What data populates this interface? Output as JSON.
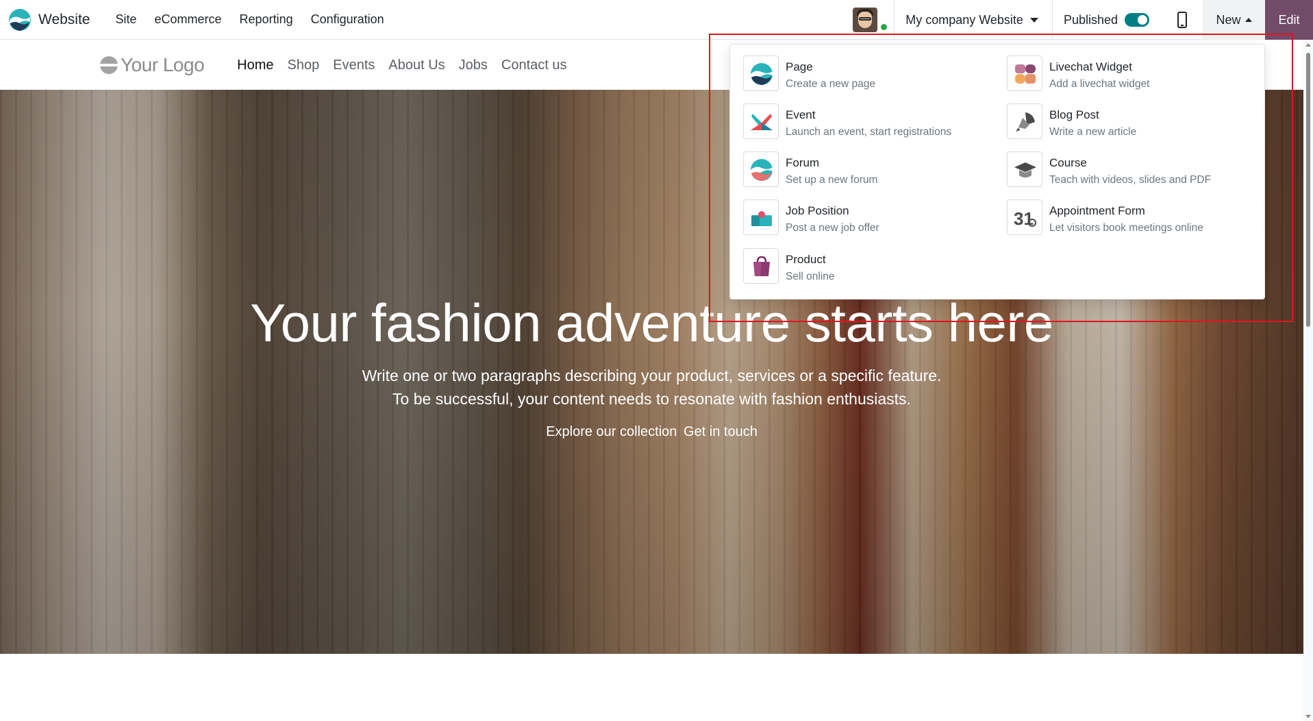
{
  "topbar": {
    "app_name": "Website",
    "menu": [
      "Site",
      "eCommerce",
      "Reporting",
      "Configuration"
    ],
    "website_selector": "My company Website",
    "published_label": "Published",
    "published": true,
    "new_label": "New",
    "edit_label": "Edit"
  },
  "site_header": {
    "logo_text": "Your Logo",
    "nav": [
      "Home",
      "Shop",
      "Events",
      "About Us",
      "Jobs",
      "Contact us"
    ],
    "active": "Home"
  },
  "hero": {
    "title": "Your fashion adventure starts here",
    "paragraph_line1": "Write one or two paragraphs describing your product, services or a specific feature.",
    "paragraph_line2": "To be successful, your content needs to resonate with fashion enthusiasts.",
    "link1": "Explore our collection",
    "link2": "Get in touch"
  },
  "new_menu": {
    "items": [
      {
        "title": "Page",
        "subtitle": "Create a new page",
        "icon": "page-icon"
      },
      {
        "title": "Livechat Widget",
        "subtitle": "Add a livechat widget",
        "icon": "livechat-icon"
      },
      {
        "title": "Event",
        "subtitle": "Launch an event, start registrations",
        "icon": "event-icon"
      },
      {
        "title": "Blog Post",
        "subtitle": "Write a new article",
        "icon": "blog-icon"
      },
      {
        "title": "Forum",
        "subtitle": "Set up a new forum",
        "icon": "forum-icon"
      },
      {
        "title": "Course",
        "subtitle": "Teach with videos, slides and PDF",
        "icon": "course-icon"
      },
      {
        "title": "Job Position",
        "subtitle": "Post a new job offer",
        "icon": "job-icon"
      },
      {
        "title": "Appointment Form",
        "subtitle": "Let visitors book meetings online",
        "icon": "appointment-icon"
      },
      {
        "title": "Product",
        "subtitle": "Sell online",
        "icon": "product-icon"
      }
    ],
    "appointment_icon_text": "31"
  },
  "colors": {
    "brand_purple": "#714b67",
    "toggle_teal": "#017e84",
    "highlight_red": "#e0141e"
  }
}
